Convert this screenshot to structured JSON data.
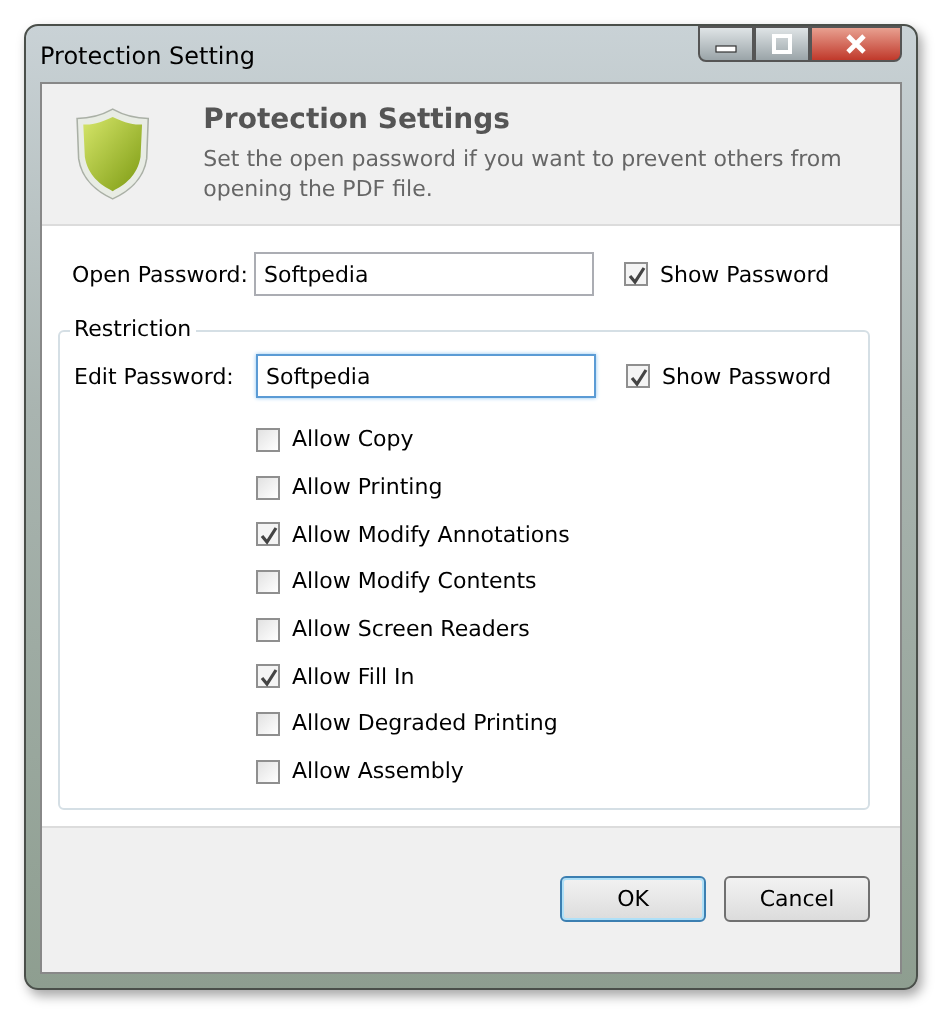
{
  "window": {
    "title": "Protection Setting"
  },
  "header": {
    "title": "Protection Settings",
    "description": "Set the open password if you want to prevent others from opening the PDF file."
  },
  "open_password": {
    "label": "Open Password:",
    "value": "Softpedia",
    "show_password": {
      "label": "Show Password",
      "checked": true
    }
  },
  "restriction": {
    "title": "Restriction",
    "edit_password": {
      "label": "Edit Password:",
      "value": "Softpedia",
      "focused": true,
      "show_password": {
        "label": "Show Password",
        "checked": true
      }
    },
    "permissions": [
      {
        "label": "Allow Copy",
        "checked": false
      },
      {
        "label": "Allow Printing",
        "checked": false
      },
      {
        "label": "Allow Modify Annotations",
        "checked": true
      },
      {
        "label": "Allow Modify Contents",
        "checked": false
      },
      {
        "label": "Allow Screen Readers",
        "checked": false
      },
      {
        "label": "Allow Fill In",
        "checked": true
      },
      {
        "label": "Allow Degraded Printing",
        "checked": false
      },
      {
        "label": "Allow Assembly",
        "checked": false
      }
    ]
  },
  "buttons": [
    {
      "label": "OK",
      "default": true
    },
    {
      "label": "Cancel",
      "default": false
    }
  ]
}
